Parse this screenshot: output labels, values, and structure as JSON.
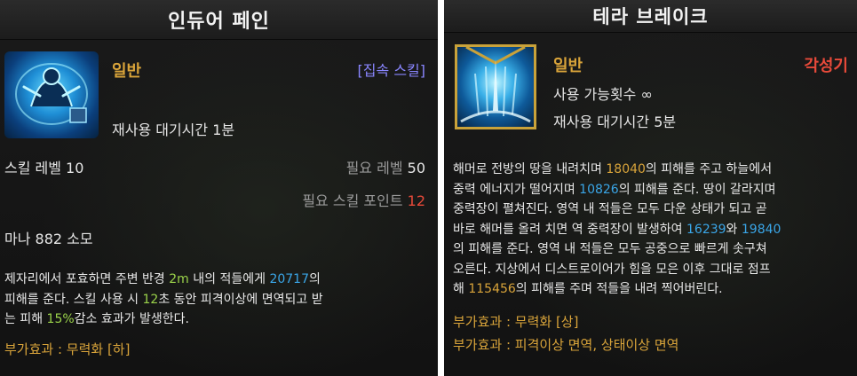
{
  "left": {
    "title": "인듀어 페인",
    "icon_name": "skill-icon-endure-pain",
    "type_label": "일반",
    "tag_label": "[집속 스킬]",
    "cooldown": "재사용 대기시간 1분",
    "skill_level": "스킬 레벨 10",
    "required_level_label": "필요 레벨",
    "required_level_value": "50",
    "required_points_label": "필요 스킬 포인트",
    "required_points_value": "12",
    "mana": "마나 882 소모",
    "desc": [
      [
        {
          "t": "제자리에서 포효하면 주변 반경 "
        },
        {
          "t": "2m",
          "c": "green"
        },
        {
          "t": " 내의 적들에게 "
        },
        {
          "t": "20717",
          "c": "blue"
        },
        {
          "t": "의"
        }
      ],
      [
        {
          "t": "피해를 준다. 스킬 사용 시 "
        },
        {
          "t": "12",
          "c": "green"
        },
        {
          "t": "초 동안 피격이상에 면역되고 받"
        }
      ],
      [
        {
          "t": "는 피해 "
        },
        {
          "t": "15%",
          "c": "green"
        },
        {
          "t": "감소 효과가 발생한다."
        }
      ]
    ],
    "extra_effect": "부가효과 : 무력화 [하]",
    "colors": {
      "gold": "#d9a43a",
      "blue": "#3aa6e8",
      "green": "#9bd34a",
      "red": "#e84a3a",
      "purple": "#8a86ff"
    }
  },
  "right": {
    "title": "테라 브레이크",
    "icon_name": "skill-icon-terra-break",
    "type_label": "일반",
    "awakening_label": "각성기",
    "usage_count": "사용 가능횟수 ∞",
    "cooldown": "재사용 대기시간 5분",
    "desc": [
      [
        {
          "t": "해머로 전방의 땅을 내려치며 "
        },
        {
          "t": "18040",
          "c": "gold"
        },
        {
          "t": "의 피해를 주고 하늘에서"
        }
      ],
      [
        {
          "t": "중력 에너지가 떨어지며 "
        },
        {
          "t": "10826",
          "c": "blue"
        },
        {
          "t": "의 피해를 준다. 땅이 갈라지며"
        }
      ],
      [
        {
          "t": "중력장이 펼쳐진다. 영역 내 적들은 모두 다운 상태가 되고 곧"
        }
      ],
      [
        {
          "t": "바로 해머를 올려 치면 역 중력장이 발생하여 "
        },
        {
          "t": "16239",
          "c": "blue"
        },
        {
          "t": "와 "
        },
        {
          "t": "19840",
          "c": "blue"
        }
      ],
      [
        {
          "t": "의 피해를 준다. 영역 내 적들은 모두 공중으로 빠르게 솟구쳐"
        }
      ],
      [
        {
          "t": "오른다. 지상에서 디스트로이어가 힘을 모은 이후 그대로 점프"
        }
      ],
      [
        {
          "t": "해 "
        },
        {
          "t": "115456",
          "c": "gold"
        },
        {
          "t": "의 피해를 주며 적들을 내려 찍어버린다."
        }
      ]
    ],
    "extra_effect_1": "부가효과 : 무력화 [상]",
    "extra_effect_2": "부가효과 : 피격이상 면역, 상태이상 면역"
  }
}
